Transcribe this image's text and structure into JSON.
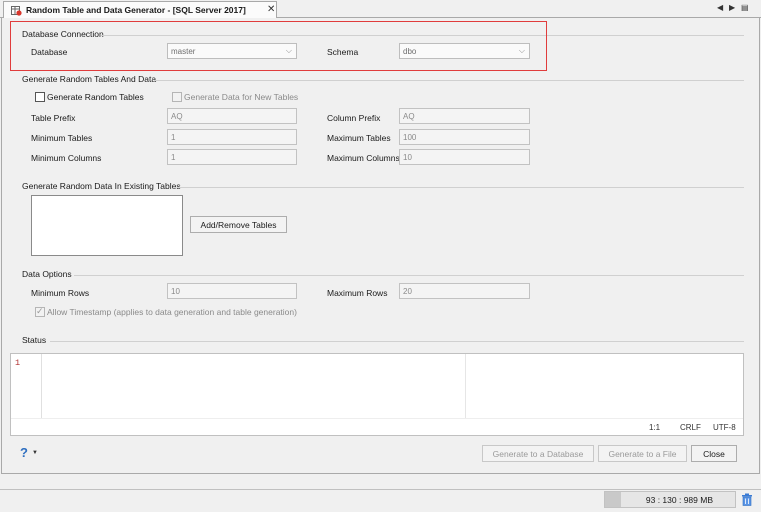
{
  "tab": {
    "title": "Random Table and Data Generator - [SQL Server 2017]",
    "close": "✕"
  },
  "tab_controls": {
    "prev": "◀",
    "next": "▶",
    "menu": "▤"
  },
  "db_connection": {
    "section": "Database Connection",
    "database_label": "Database",
    "database_value": "master",
    "schema_label": "Schema",
    "schema_value": "dbo"
  },
  "gen_tables": {
    "section": "Generate Random Tables And Data",
    "gen_random_tables": "Generate Random Tables",
    "gen_data_new_tables": "Generate Data for New Tables",
    "table_prefix_label": "Table Prefix",
    "table_prefix_value": "AQ",
    "column_prefix_label": "Column Prefix",
    "column_prefix_value": "AQ",
    "min_tables_label": "Minimum Tables",
    "min_tables_value": "1",
    "max_tables_label": "Maximum Tables",
    "max_tables_value": "100",
    "min_columns_label": "Minimum Columns",
    "min_columns_value": "1",
    "max_columns_label": "Maximum Columns",
    "max_columns_value": "10"
  },
  "existing": {
    "section": "Generate Random Data In Existing Tables",
    "add_remove": "Add/Remove Tables"
  },
  "data_options": {
    "section": "Data Options",
    "min_rows_label": "Minimum Rows",
    "min_rows_value": "10",
    "max_rows_label": "Maximum Rows",
    "max_rows_value": "20",
    "allow_timestamp": "Allow Timestamp (applies to data generation and table generation)"
  },
  "status": {
    "section": "Status",
    "line_number": "1",
    "cursor_pos": "1:1",
    "line_ending": "CRLF",
    "encoding": "UTF-8"
  },
  "actions": {
    "help": "?",
    "generate_db": "Generate to a Database",
    "generate_file": "Generate to a File",
    "close": "Close"
  },
  "memory": {
    "text": "93 : 130 : 989 MB"
  },
  "colors": {
    "highlight": "#e03c3c",
    "line_number": "#b03030",
    "help_icon": "#2f6fc0"
  }
}
